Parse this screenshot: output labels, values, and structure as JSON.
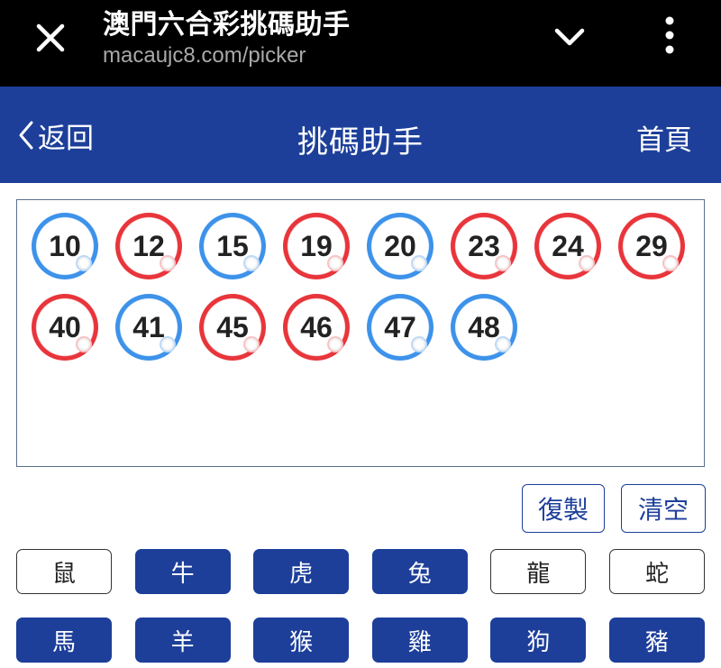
{
  "browser": {
    "title": "澳門六合彩挑碼助手",
    "url": "macaujc8.com/picker",
    "icons": [
      "close-icon",
      "chevron-down-icon",
      "more-vertical-icon"
    ]
  },
  "header": {
    "back_label": "返回",
    "title": "挑碼助手",
    "home_label": "首頁",
    "color": "#1d3f9a"
  },
  "numbers": [
    {
      "value": "10",
      "color": "blue"
    },
    {
      "value": "12",
      "color": "red"
    },
    {
      "value": "15",
      "color": "blue"
    },
    {
      "value": "19",
      "color": "red"
    },
    {
      "value": "20",
      "color": "blue"
    },
    {
      "value": "23",
      "color": "red"
    },
    {
      "value": "24",
      "color": "red"
    },
    {
      "value": "29",
      "color": "red"
    },
    {
      "value": "40",
      "color": "red"
    },
    {
      "value": "41",
      "color": "blue"
    },
    {
      "value": "45",
      "color": "red"
    },
    {
      "value": "46",
      "color": "red"
    },
    {
      "value": "47",
      "color": "blue"
    },
    {
      "value": "48",
      "color": "blue"
    }
  ],
  "actions": {
    "copy_label": "復製",
    "clear_label": "清空"
  },
  "zodiac": [
    {
      "label": "鼠",
      "selected": false
    },
    {
      "label": "牛",
      "selected": true
    },
    {
      "label": "虎",
      "selected": true
    },
    {
      "label": "兔",
      "selected": true
    },
    {
      "label": "龍",
      "selected": false
    },
    {
      "label": "蛇",
      "selected": false
    },
    {
      "label": "馬",
      "selected": true
    },
    {
      "label": "羊",
      "selected": true
    },
    {
      "label": "猴",
      "selected": true
    },
    {
      "label": "雞",
      "selected": true
    },
    {
      "label": "狗",
      "selected": true
    },
    {
      "label": "豬",
      "selected": true
    }
  ],
  "colors": {
    "ball_red": "#e8353b",
    "ball_blue": "#3d92ea",
    "accent": "#1d3f9a"
  }
}
